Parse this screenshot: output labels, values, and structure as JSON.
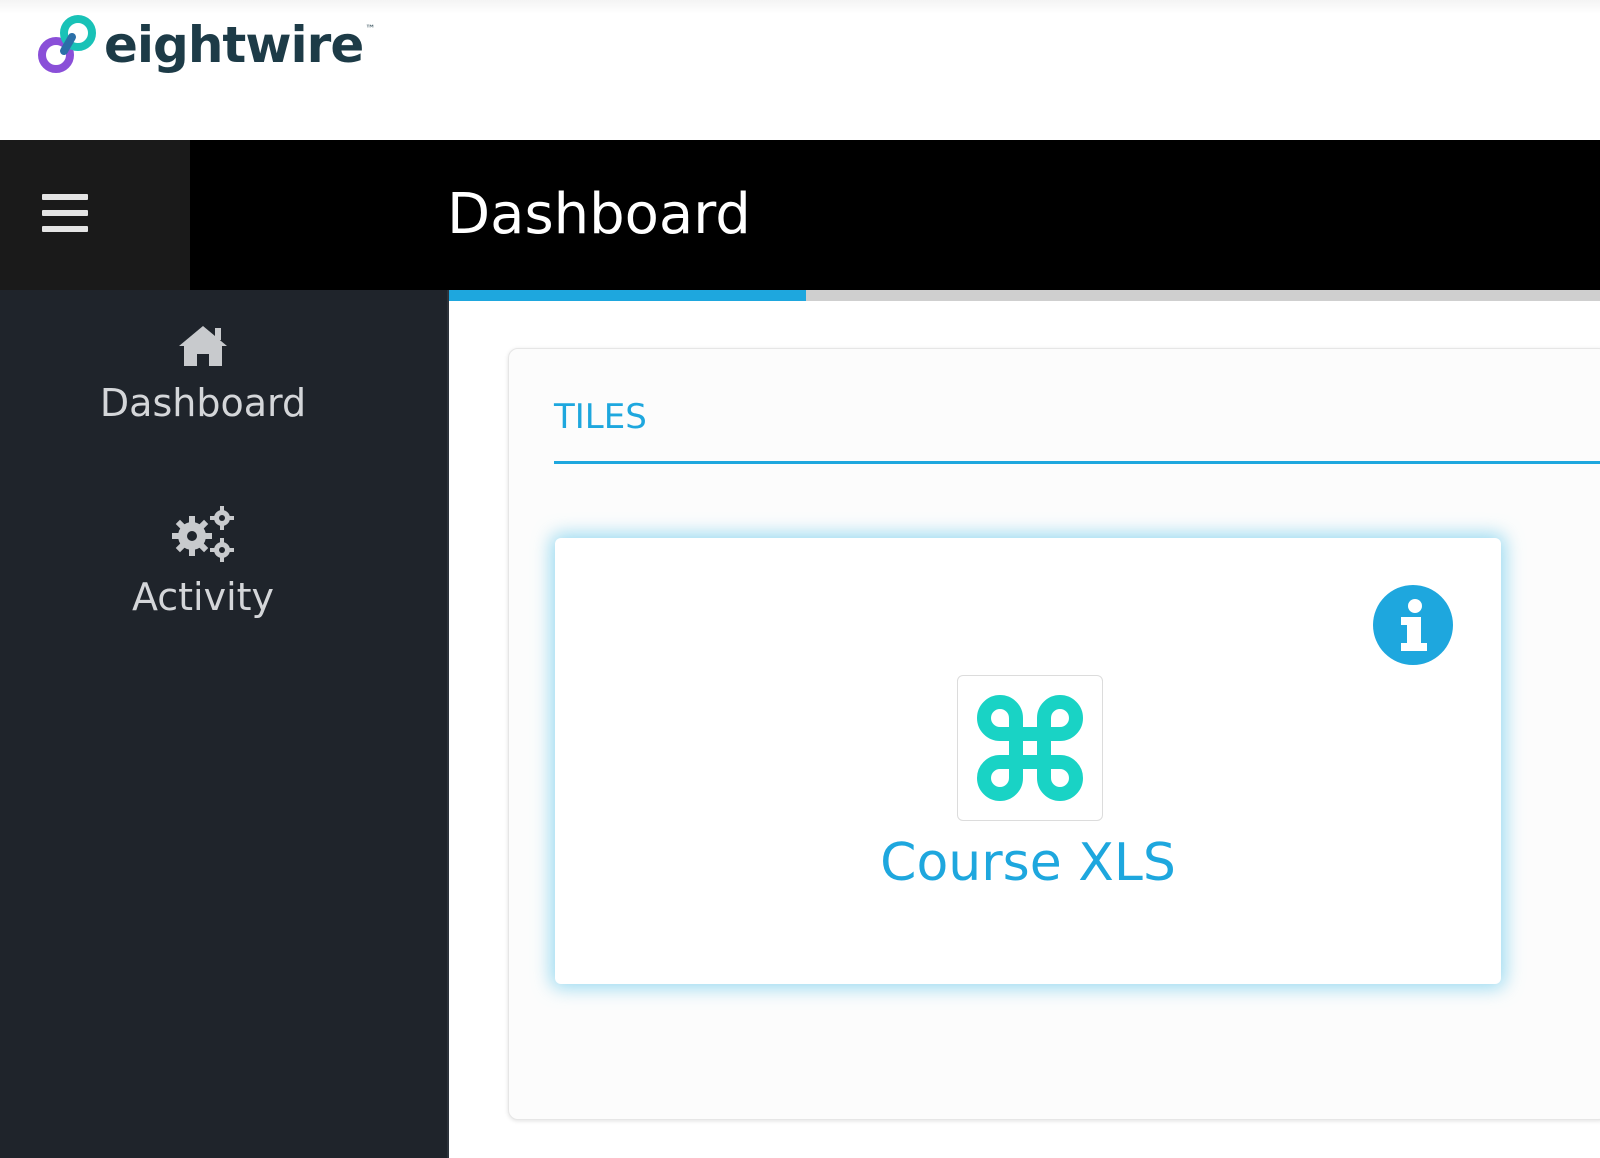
{
  "brand": {
    "name": "eightwire",
    "trademark": "™",
    "colors": {
      "teal": "#19c2b7",
      "purple": "#8a4fd8",
      "text": "#1d3b47"
    }
  },
  "header": {
    "title": "Dashboard",
    "menu_icon": "hamburger-menu-icon"
  },
  "progress": {
    "value": 0.31,
    "color": "#1ea7de"
  },
  "sidebar": {
    "items": [
      {
        "label": "Dashboard",
        "icon": "home-icon"
      },
      {
        "label": "Activity",
        "icon": "gears-icon"
      }
    ]
  },
  "main": {
    "section_title": "TILES",
    "tiles": [
      {
        "label": "Course XLS",
        "icon": "command-key-icon",
        "info_icon": "info-icon"
      }
    ]
  },
  "colors": {
    "accent": "#1ea7de",
    "sidebar_bg": "#1f242b",
    "header_bg": "#000000"
  }
}
